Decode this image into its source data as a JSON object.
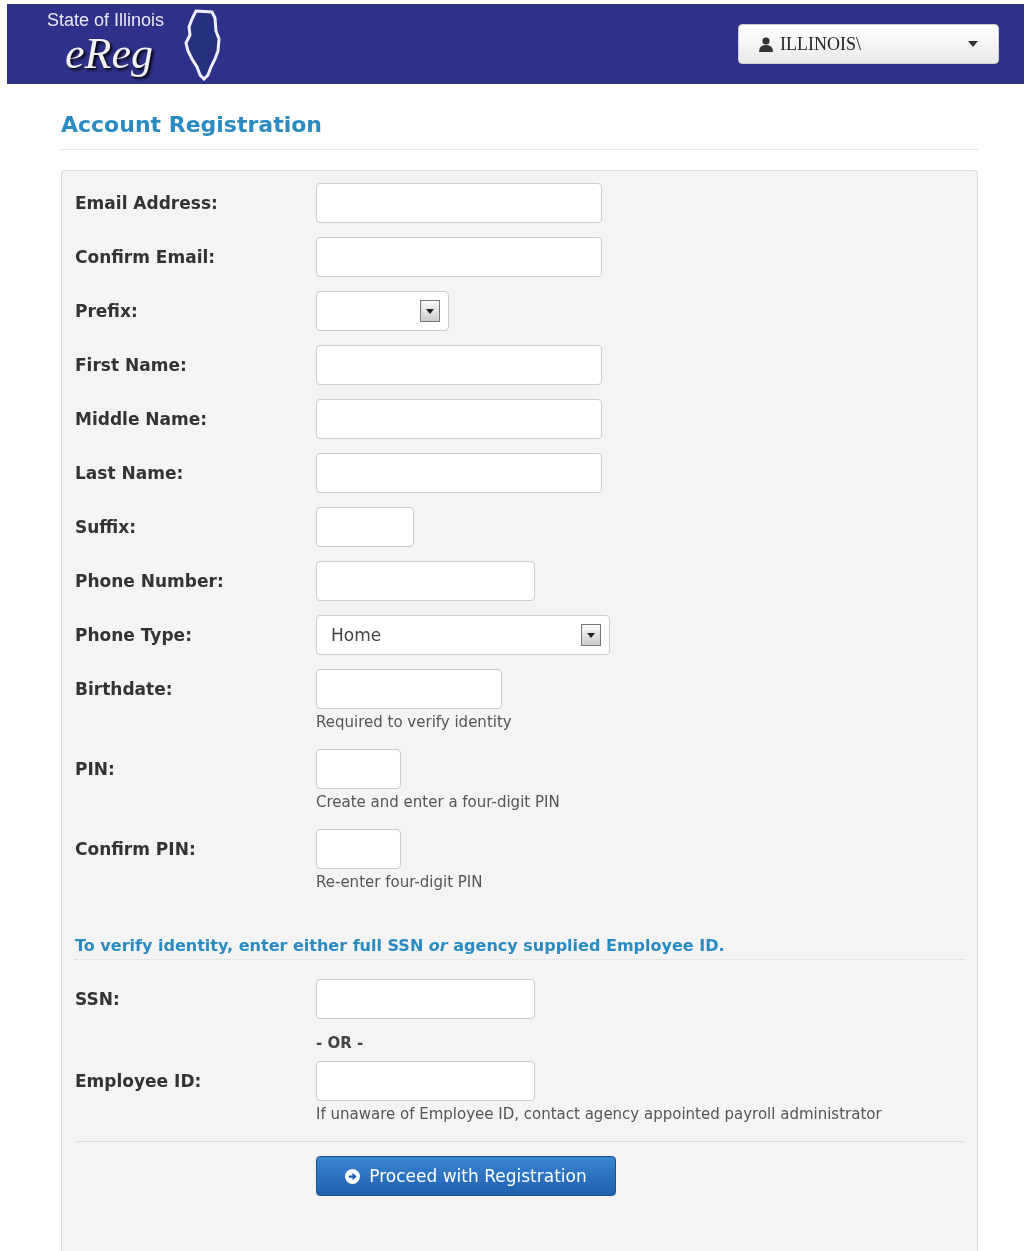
{
  "header": {
    "tagline": "State of Illinois",
    "logo_name": "eReg",
    "user_menu": {
      "label": "ILLINOIS\\"
    }
  },
  "title": "Account Registration",
  "fields": [
    {
      "label": "Email Address:",
      "kind": "text"
    },
    {
      "label": "Confirm Email:",
      "kind": "text"
    },
    {
      "label": "Prefix:",
      "kind": "select"
    },
    {
      "label": "First Name:",
      "kind": "text"
    },
    {
      "label": "Middle Name:",
      "kind": "text"
    },
    {
      "label": "Last Name:",
      "kind": "text"
    },
    {
      "label": "Suffix:",
      "kind": "text"
    },
    {
      "label": "Phone Number:",
      "kind": "text"
    },
    {
      "label": "Phone Type:",
      "kind": "select",
      "value": "Home"
    },
    {
      "label": "Birthdate:",
      "kind": "text",
      "help": "Required to verify identity"
    },
    {
      "label": "PIN:",
      "kind": "text",
      "help": "Create and enter a four-digit PIN"
    },
    {
      "label": "Confirm PIN:",
      "kind": "text",
      "help": "Re-enter four-digit PIN"
    }
  ],
  "identity_note": "To verify identity, enter either full SSN *or* agency supplied Employee ID.",
  "identity_fields": [
    {
      "label": "SSN:",
      "kind": "text"
    },
    {
      "kind": "separator",
      "text": "- OR -"
    },
    {
      "label": "Employee ID:",
      "kind": "text",
      "help": "If unaware of Employee ID, contact agency appointed payroll administrator"
    }
  ],
  "submit_button": "Proceed with Registration"
}
